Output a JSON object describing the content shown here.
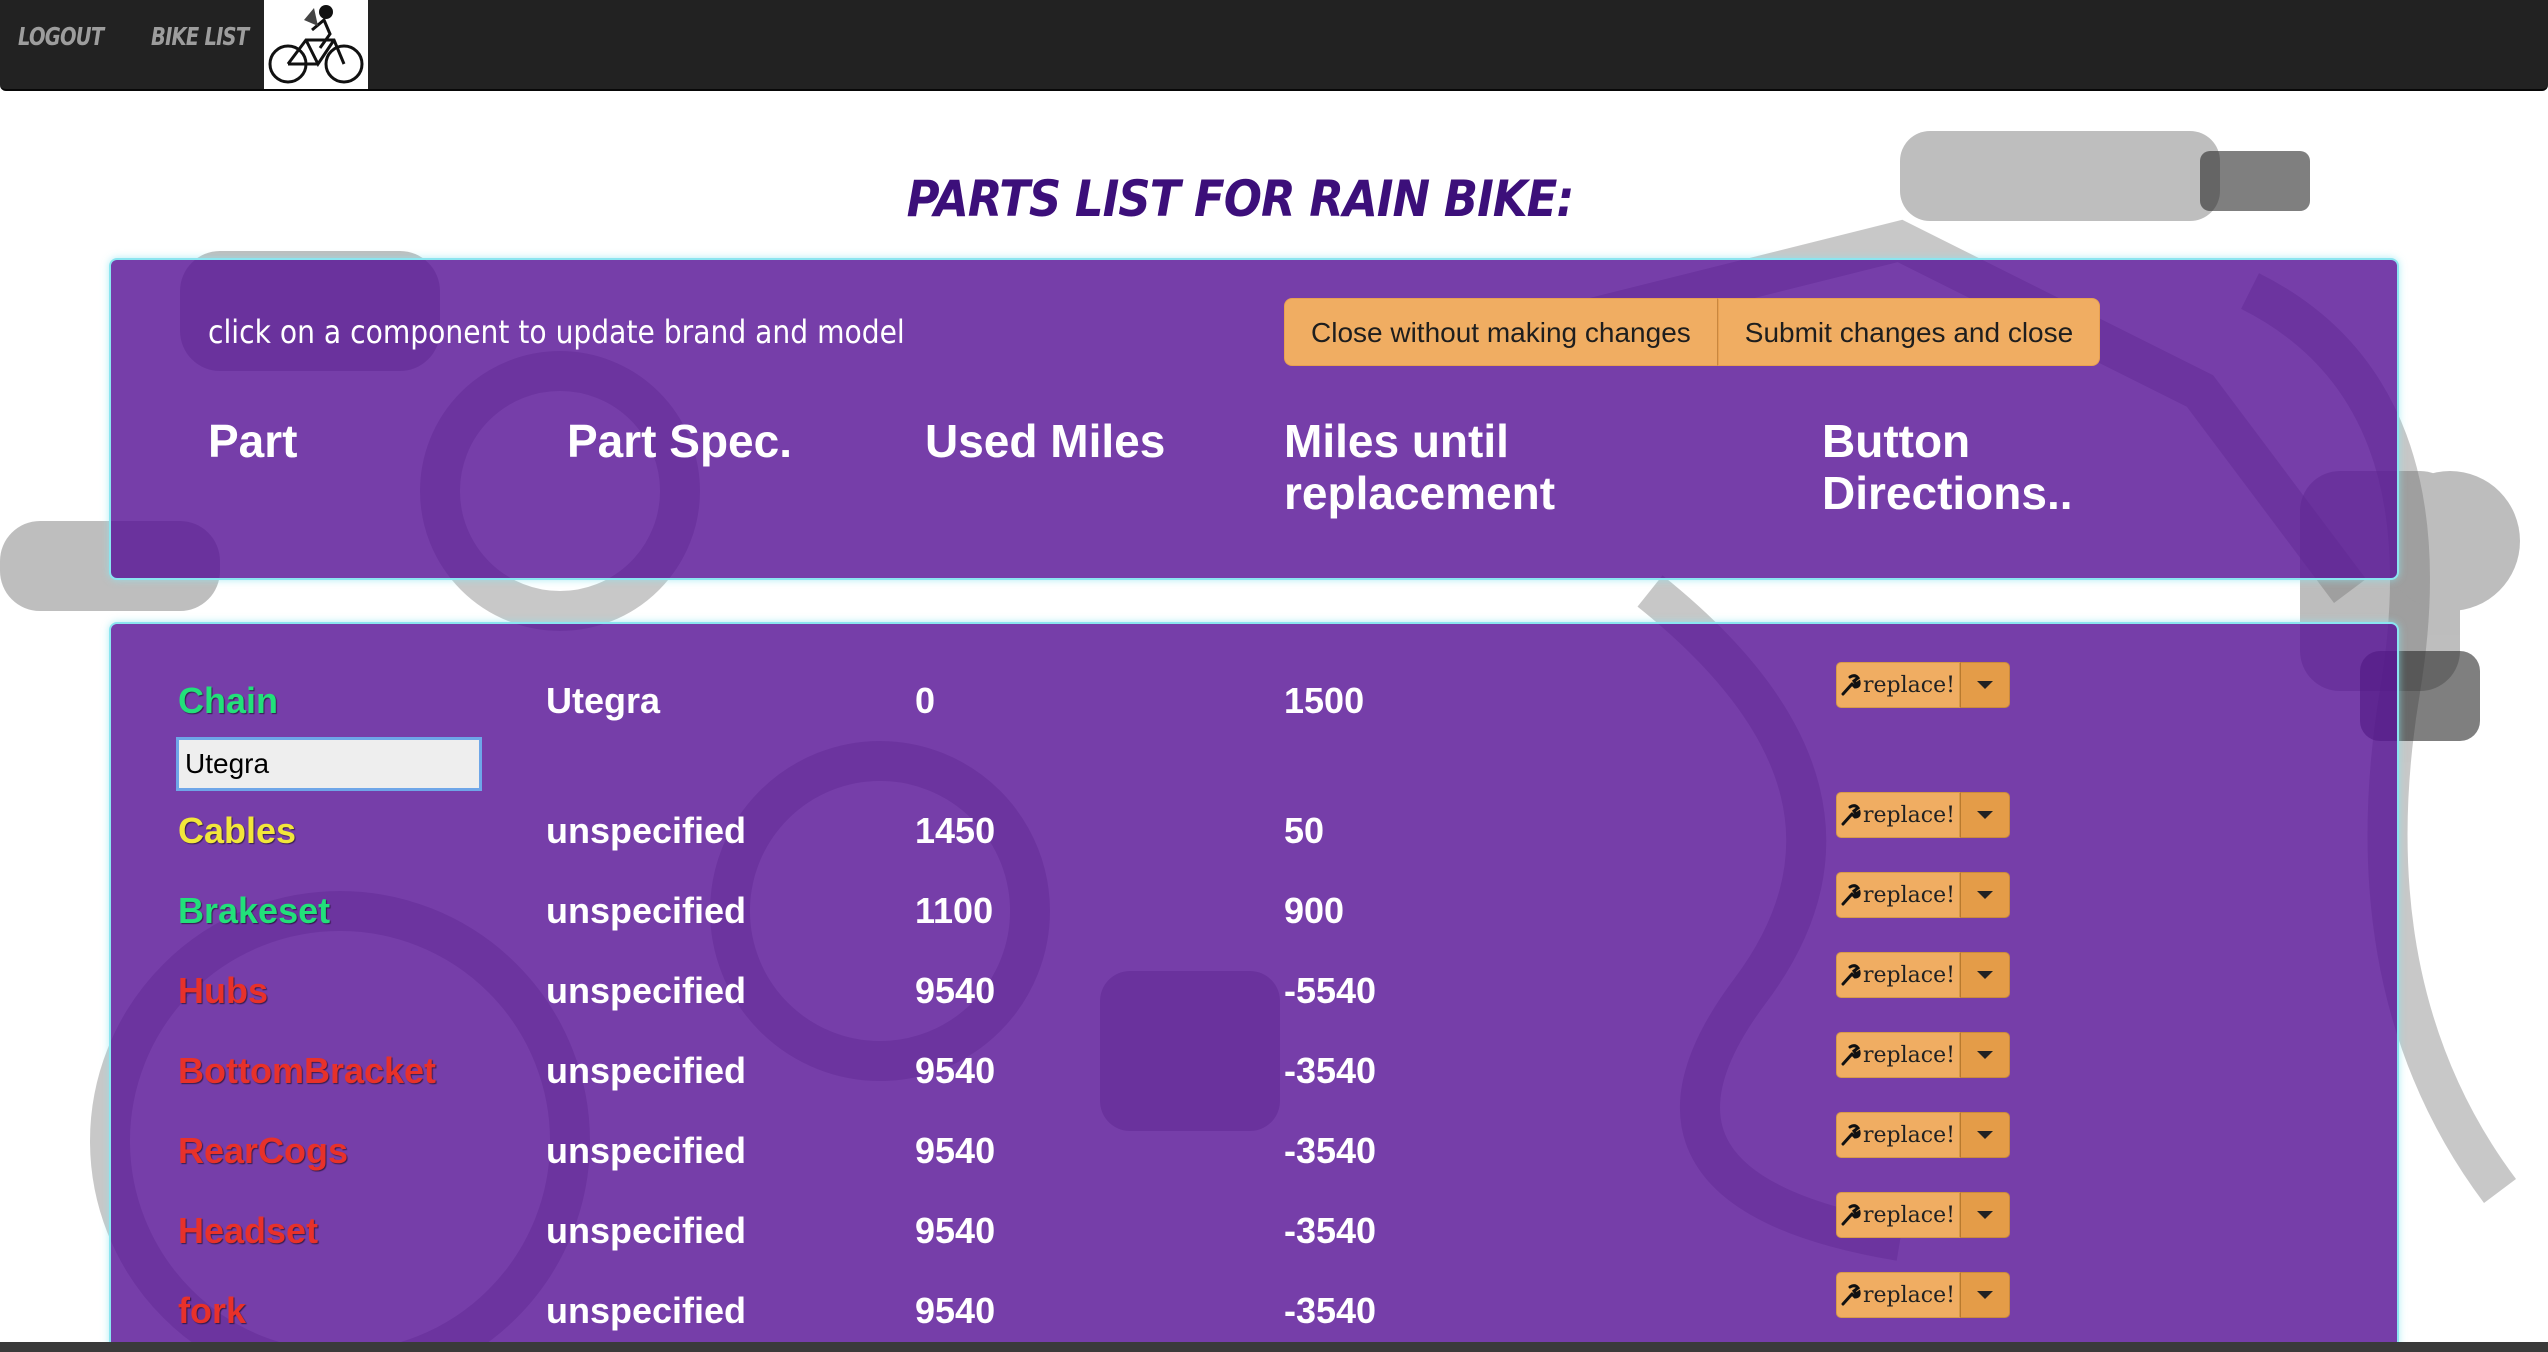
{
  "nav": {
    "logout": "logout",
    "bike_list": "bike list",
    "logo_icon": "cyclist-logo-icon"
  },
  "page_title": "Parts List for Rain Bike:",
  "instructions": "click on a component to update brand and model",
  "buttons": {
    "close_without": "Close without making changes",
    "submit_close": "Submit changes and close"
  },
  "columns": {
    "part": "Part",
    "spec": "Part Spec.",
    "used": "Used Miles",
    "until_1": "Miles until",
    "until_2": "replacement",
    "dir_1": "Button",
    "dir_2": "Directions.."
  },
  "edit_input_value": "Utegra",
  "replace_label": "replace!",
  "colors": {
    "ok": "#22e07a",
    "warn": "#f2e63a",
    "overdue": "#e8312a",
    "panel": "#5a1496",
    "button": "#f0ad62"
  },
  "rows": [
    {
      "part": "Chain",
      "spec": "Utegra",
      "used": "0",
      "until": "1500",
      "status": "ok"
    },
    {
      "part": "Cables",
      "spec": "unspecified",
      "used": "1450",
      "until": "50",
      "status": "warn"
    },
    {
      "part": "Brakeset",
      "spec": "unspecified",
      "used": "1100",
      "until": "900",
      "status": "ok"
    },
    {
      "part": "Hubs",
      "spec": "unspecified",
      "used": "9540",
      "until": "-5540",
      "status": "overdue"
    },
    {
      "part": "BottomBracket",
      "spec": "unspecified",
      "used": "9540",
      "until": "-3540",
      "status": "overdue"
    },
    {
      "part": "RearCogs",
      "spec": "unspecified",
      "used": "9540",
      "until": "-3540",
      "status": "overdue"
    },
    {
      "part": "Headset",
      "spec": "unspecified",
      "used": "9540",
      "until": "-3540",
      "status": "overdue"
    },
    {
      "part": "fork",
      "spec": "unspecified",
      "used": "9540",
      "until": "-3540",
      "status": "overdue"
    }
  ]
}
